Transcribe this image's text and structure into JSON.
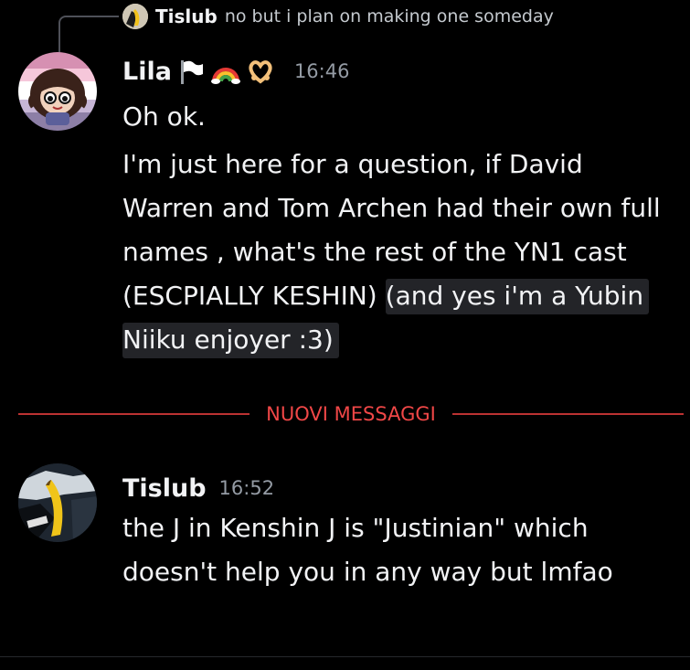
{
  "reply_preview": {
    "author": "Tislub",
    "text": "no but i plan on making one someday"
  },
  "messages": [
    {
      "author": "Lila",
      "badges": [
        "white-flag-icon",
        "rainbow-icon",
        "heart-hands-icon"
      ],
      "timestamp": "16:46",
      "line1": "Oh ok.",
      "text_main": "I'm just here for a question, if David Warren and Tom Archen had their own full names , what's the rest of the YN1 cast (ESCPIALLY KESHIN) ",
      "text_highlight": "(and yes i'm a Yubin Niiku enjoyer :3)"
    },
    {
      "author": "Tislub",
      "timestamp": "16:52",
      "text": "the J in Kenshin J is \"Justinian\" which doesn't help you in any way but lmfao"
    }
  ],
  "divider": {
    "label": "NUOVI MESSAGGI"
  },
  "colors": {
    "background": "#000000",
    "text": "#f2f3f5",
    "muted": "#949ba4",
    "new_messages": "#f04747",
    "highlight_bg": "#232428"
  }
}
